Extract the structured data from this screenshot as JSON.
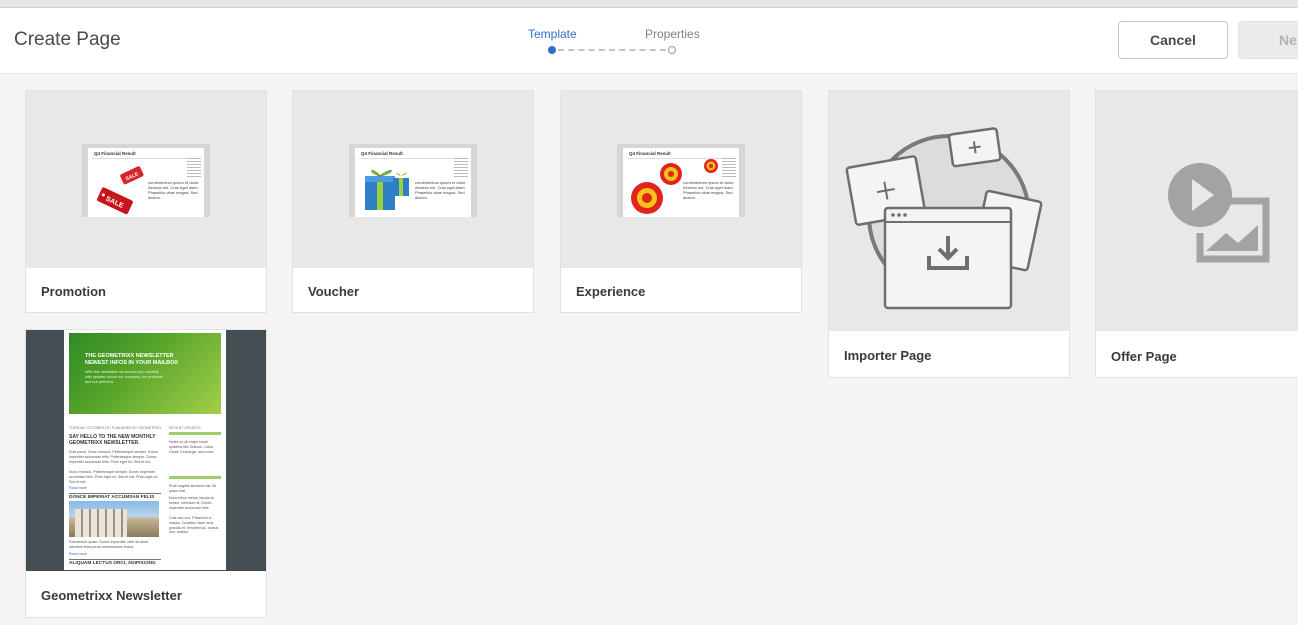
{
  "header": {
    "title": "Create Page",
    "cancel_label": "Cancel",
    "next_label": "Next"
  },
  "wizard": {
    "steps": [
      {
        "label": "Template",
        "state": "active"
      },
      {
        "label": "Properties",
        "state": "inactive"
      }
    ]
  },
  "templates": [
    {
      "name": "Promotion",
      "thumb_heading": "Q4 Financial Result",
      "thumb_text": "condimentum ipsum et dolor. Aenean est. Cras eget diam. Phasellus vitae magna. Sed dictum.",
      "sale_tag": "SALE"
    },
    {
      "name": "Voucher",
      "thumb_heading": "Q4 Financial Result",
      "thumb_text": "condimentum ipsum et dolor. Aenean est. Cras eget diam. Phasellus vitae magna. Sed dictum."
    },
    {
      "name": "Experience",
      "thumb_heading": "Q4 Financial Result",
      "thumb_text": "condimentum ipsum et dolor. Aenean est. Cras eget diam. Phasellus vitae magna. Sed dictum."
    },
    {
      "name": "Importer Page"
    },
    {
      "name": "Offer Page"
    },
    {
      "name": "Geometrixx Newsletter",
      "newsletter": {
        "hero_title_1": "THE GEOMETRIXX NEWSLETTER",
        "hero_title_2": "NEWEST INFOS IN YOUR MAILBOX",
        "hero_sub": "With this newsletter we provide you monthly with updates about our company, our products and our partners.",
        "meta": "TUESDAY, OCTOBER 23 | PUBLISHED BY GEOMETRIXX",
        "side_title": "RECENT UPDATES",
        "heading_1": "SAY HELLO TO THE NEW MONTHLY GEOMETRIXX NEWSLETTER.",
        "body_1": "Duis purus. Nunc rhoncus. Pellentesque semper. Donec imperdiet accumsan felis. Pellentesque semper. Donec imperdiet accumsan felis. Proin eget mi. Sed et est.",
        "body_2": "Nunc rhoncus. Pellentesque semper. Donec imperdiet accumsan felis. Proin eget mi. Sed et est. Proin eget mi. Sed et est.",
        "read_more": "Read more",
        "heading_2": "DONCE IMPERIAT ACCUMSAN FELIS",
        "body_3": "Fermentum quam. Donec imperdiet, nibh sit amet, interdum felis purus condimentum lectus.",
        "heading_3": "ALIQUAM LECTUS ORCI, ADIPISCING",
        "side_1": "Notes on all major email systems like Outlook, Lotus, Gmail, Exchange, and more.",
        "side_2": "Proin sagittis tincidunt nisi. All quam erat.",
        "side_3": "Nunc tellus metus, iaculis at, ornare, interdum at, Donec imperdiet accumsan felis.",
        "side_4": "Cras sed orci. Phasellus in massa. Curabitur dolor eros, gravida et, hendrerit ac, cursus non, massa."
      }
    }
  ]
}
